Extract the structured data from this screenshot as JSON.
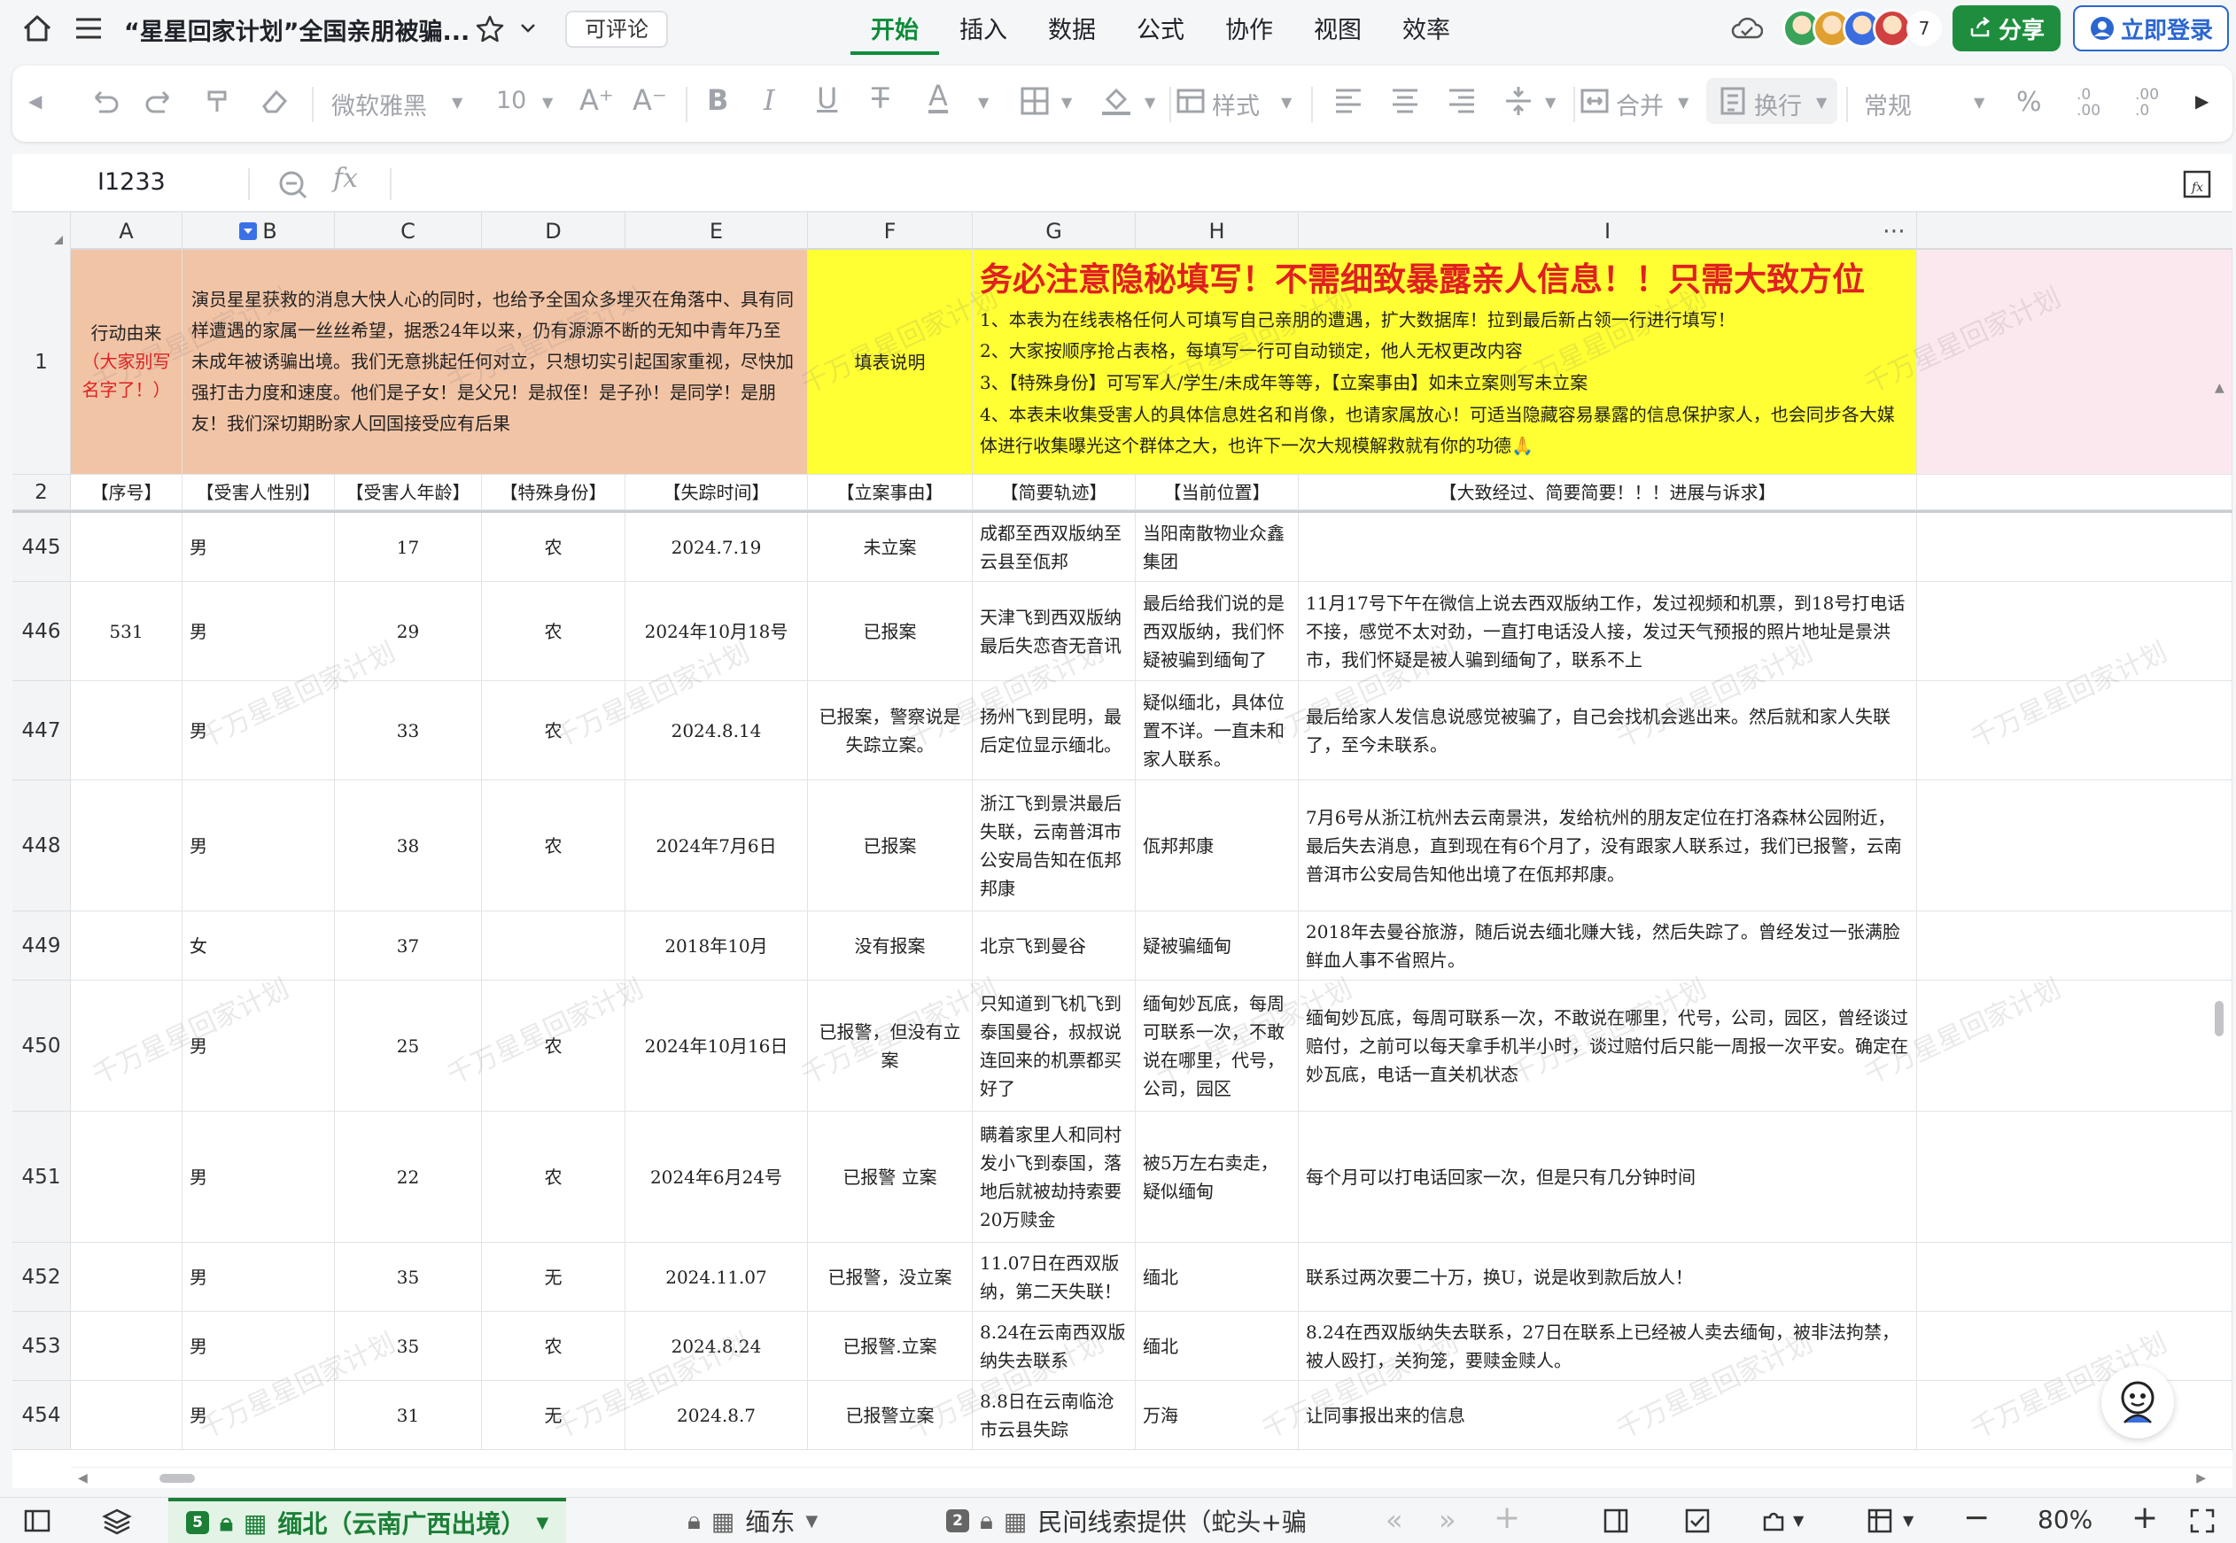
{
  "topbar": {
    "title": "“星星回家计划”全国亲朋被骗...",
    "comment_badge": "可评论",
    "tabs": [
      "开始",
      "插入",
      "数据",
      "公式",
      "协作",
      "视图",
      "效率"
    ],
    "active_tab": "开始",
    "collaborators_count": "7",
    "share_label": "分享",
    "login_label": "立即登录",
    "accent_color": "#1e8e3e"
  },
  "toolbar": {
    "font_name": "微软雅黑",
    "font_size": "10",
    "style_label": "样式",
    "merge_label": "合并",
    "wrap_label": "换行",
    "format_label": "常规"
  },
  "formula_bar": {
    "cell_ref": "I1233",
    "fx_label": "fx"
  },
  "watermark": "千万星星回家计划",
  "columns": [
    "A",
    "B",
    "C",
    "D",
    "E",
    "F",
    "G",
    "H",
    "I"
  ],
  "row1": {
    "num": "1",
    "a_text_black": "行动由来",
    "a_text_red": "（大家别写名字了！）",
    "b_text": "演员星星获救的消息大快人心的同时，也给予全国众多埋灭在角落中、具有同样遭遇的家属一丝丝希望，据悉24年以来，仍有源源不断的无知中青年乃至未成年被诱骗出境。我们无意挑起任何对立，只想切实引起国家重视，尽快加强打击力度和速度。他们是子女！是父兄！是叔侄！是子孙！是同学！是朋友！我们深切期盼家人回国接受应有后果",
    "f_text": "填表说明",
    "g_title": "务必注意隐秘填写！不需细致暴露亲人信息！！只需大致方位",
    "g_lines": [
      "1、本表为在线表格任何人可填写自己亲朋的遭遇，扩大数据库！拉到最后新占领一行进行填写！",
      "2、大家按顺序抢占表格，每填写一行可自动锁定，他人无权更改内容",
      "3、【特殊身份】可写军人/学生/未成年等等，【立案事由】如未立案则写未立案",
      "4、本表未收集受害人的具体信息姓名和肖像，也请家属放心！可适当隐藏容易暴露的信息保护家人，也会同步各大媒体进行收集曝光这个群体之大，也许下一次大规模解救就有你的功德🙏"
    ]
  },
  "row2": {
    "num": "2",
    "headers": [
      "【序号】",
      "【受害人性别】",
      "【受害人年龄】",
      "【特殊身份】",
      "【失踪时间】",
      "【立案事由】",
      "【简要轨迹】",
      "【当前位置】",
      "【大致经过、简要简要！！！进展与诉求】"
    ]
  },
  "rows": [
    {
      "num": "445",
      "seq": "",
      "gender": "男",
      "age": "17",
      "identity": "农",
      "time": "2024.7.19",
      "case": "未立案",
      "track": "成都至西双版纳至云县至佤邦",
      "location": "当阳南散物业众鑫集团",
      "detail": ""
    },
    {
      "num": "446",
      "seq": "531",
      "gender": "男",
      "age": "29",
      "identity": "农",
      "time": "2024年10月18号",
      "case": "已报案",
      "track": "天津飞到西双版纳最后失恋杳无音讯",
      "location": "最后给我们说的是西双版纳，我们怀疑被骗到缅甸了",
      "detail": "11月17号下午在微信上说去西双版纳工作，发过视频和机票，到18号打电话不接，感觉不太对劲，一直打电话没人接，发过天气预报的照片地址是景洪市，我们怀疑是被人骗到缅甸了，联系不上"
    },
    {
      "num": "447",
      "seq": "",
      "gender": "男",
      "age": "33",
      "identity": "农",
      "time": "2024.8.14",
      "case": "已报案，警察说是失踪立案。",
      "track": "扬州飞到昆明，最后定位显示缅北。",
      "location": "疑似缅北，具体位置不详。一直未和家人联系。",
      "detail": "最后给家人发信息说感觉被骗了，自己会找机会逃出来。然后就和家人失联了，至今未联系。"
    },
    {
      "num": "448",
      "seq": "",
      "gender": "男",
      "age": "38",
      "identity": "农",
      "time": "2024年7月6日",
      "case": "已报案",
      "track": "浙江飞到景洪最后失联，云南普洱市公安局告知在佤邦邦康",
      "location": "佤邦邦康",
      "detail": "7月6号从浙江杭州去云南景洪，发给杭州的朋友定位在打洛森林公园附近，最后失去消息，直到现在有6个月了，没有跟家人联系过，我们已报警，云南普洱市公安局告知他出境了在佤邦邦康。"
    },
    {
      "num": "449",
      "seq": "",
      "gender": "女",
      "age": "37",
      "identity": "",
      "time": "2018年10月",
      "case": "没有报案",
      "track": "北京飞到曼谷",
      "location": "疑被骗缅甸",
      "detail": "2018年去曼谷旅游，随后说去缅北赚大钱，然后失踪了。曾经发过一张满脸鲜血人事不省照片。"
    },
    {
      "num": "450",
      "seq": "",
      "gender": "男",
      "age": "25",
      "identity": "农",
      "time": "2024年10月16日",
      "case": "已报警，但没有立案",
      "track": "只知道到飞机飞到泰国曼谷，叔叔说连回来的机票都买好了",
      "location": "缅甸妙瓦底，每周可联系一次，不敢说在哪里，代号，公司，园区",
      "detail": "缅甸妙瓦底，每周可联系一次，不敢说在哪里，代号，公司，园区，曾经谈过赔付，之前可以每天拿手机半小时，谈过赔付后只能一周报一次平安。确定在妙瓦底，电话一直关机状态"
    },
    {
      "num": "451",
      "seq": "",
      "gender": "男",
      "age": "22",
      "identity": "农",
      "time": "2024年6月24号",
      "case": "已报警 立案",
      "track": "瞒着家里人和同村发小飞到泰国，落地后就被劫持索要20万赎金",
      "location": "被5万左右卖走，疑似缅甸",
      "detail": "每个月可以打电话回家一次，但是只有几分钟时间"
    },
    {
      "num": "452",
      "seq": "",
      "gender": "男",
      "age": "35",
      "identity": "无",
      "time": "2024.11.07",
      "case": "已报警，没立案",
      "track": "11.07日在西双版纳，第二天失联！",
      "location": "缅北",
      "detail": "联系过两次要二十万，换U，说是收到款后放人！"
    },
    {
      "num": "453",
      "seq": "",
      "gender": "男",
      "age": "35",
      "identity": "农",
      "time": "2024.8.24",
      "case": "已报警.立案",
      "track": "8.24在云南西双版纳失去联系",
      "location": "缅北",
      "detail": "8.24在西双版纳失去联系，27日在联系上已经被人卖去缅甸，被非法拘禁，被人殴打，关狗笼，要赎金赎人。"
    },
    {
      "num": "454",
      "seq": "",
      "gender": "男",
      "age": "31",
      "identity": "无",
      "time": "2024.8.7",
      "case": "已报警立案",
      "track": "8.8日在云南临沧市云县失踪",
      "location": "万海",
      "detail": "让同事报出来的信息"
    }
  ],
  "sheetbar": {
    "tabs": [
      {
        "badge": "5",
        "label": "缅北（云南广西出境）",
        "active": true
      },
      {
        "badge": "",
        "label": "缅东",
        "active": false
      },
      {
        "badge": "2",
        "label": "民间线索提供（蛇头+骗",
        "active": false
      }
    ],
    "zoom": "80%"
  }
}
